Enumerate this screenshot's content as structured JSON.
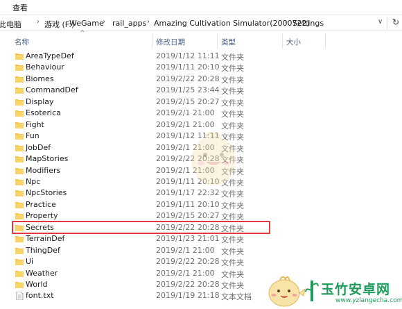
{
  "menubar": {
    "view_label": "查看"
  },
  "breadcrumb": {
    "items": [
      "此电脑",
      "游戏 (F:)",
      "WeGame",
      "rail_apps",
      "Amazing Cultivation Simulator(2000722)",
      "Settings"
    ]
  },
  "columns": {
    "name": "名称",
    "modified": "修改日期",
    "type": "类型",
    "size": "大小"
  },
  "files": [
    {
      "name": "AreaTypeDef",
      "date": "2019/1/12 11:11",
      "type": "文件夹",
      "kind": "folder"
    },
    {
      "name": "Behaviour",
      "date": "2019/1/11 20:10",
      "type": "文件夹",
      "kind": "folder"
    },
    {
      "name": "Biomes",
      "date": "2019/2/22 20:28",
      "type": "文件夹",
      "kind": "folder"
    },
    {
      "name": "CommandDef",
      "date": "2019/1/25 23:44",
      "type": "文件夹",
      "kind": "folder"
    },
    {
      "name": "Display",
      "date": "2019/2/15 20:27",
      "type": "文件夹",
      "kind": "folder"
    },
    {
      "name": "Esoterica",
      "date": "2019/2/1 21:00",
      "type": "文件夹",
      "kind": "folder"
    },
    {
      "name": "Fight",
      "date": "2019/2/1 21:00",
      "type": "文件夹",
      "kind": "folder"
    },
    {
      "name": "Fun",
      "date": "2019/1/12 11:11",
      "type": "文件夹",
      "kind": "folder"
    },
    {
      "name": "JobDef",
      "date": "2019/2/1 21:00",
      "type": "文件夹",
      "kind": "folder"
    },
    {
      "name": "MapStories",
      "date": "2019/2/22 20:28",
      "type": "文件夹",
      "kind": "folder"
    },
    {
      "name": "Modifiers",
      "date": "2019/2/1 21:00",
      "type": "文件夹",
      "kind": "folder"
    },
    {
      "name": "Npc",
      "date": "2019/1/11 20:10",
      "type": "文件夹",
      "kind": "folder"
    },
    {
      "name": "NpcStories",
      "date": "2019/1/17 22:32",
      "type": "文件夹",
      "kind": "folder"
    },
    {
      "name": "Practice",
      "date": "2019/1/11 20:10",
      "type": "文件夹",
      "kind": "folder"
    },
    {
      "name": "Property",
      "date": "2019/2/15 20:27",
      "type": "文件夹",
      "kind": "folder"
    },
    {
      "name": "Secrets",
      "date": "2019/2/22 20:28",
      "type": "文件夹",
      "kind": "folder",
      "highlighted": true
    },
    {
      "name": "TerrainDef",
      "date": "2019/1/23 21:01",
      "type": "文件夹",
      "kind": "folder"
    },
    {
      "name": "ThingDef",
      "date": "2019/2/1 21:00",
      "type": "文件夹",
      "kind": "folder"
    },
    {
      "name": "Ui",
      "date": "2019/2/22 20:28",
      "type": "文件夹",
      "kind": "folder"
    },
    {
      "name": "Weather",
      "date": "2019/2/1 21:00",
      "type": "文件夹",
      "kind": "folder"
    },
    {
      "name": "World",
      "date": "2019/2/22 20:28",
      "type": "文件夹",
      "kind": "folder"
    },
    {
      "name": "font.txt",
      "date": "2019/1/19 21:18",
      "type": "文本文档",
      "kind": "text"
    }
  ],
  "watermark": {
    "site_name": "玉竹安卓网",
    "site_url": "www.yzlangecha.com"
  },
  "colors": {
    "folder": "#f5c54a",
    "highlight": "#e0393e",
    "header_text": "#4d6082",
    "brand": "#1d9b5a"
  }
}
